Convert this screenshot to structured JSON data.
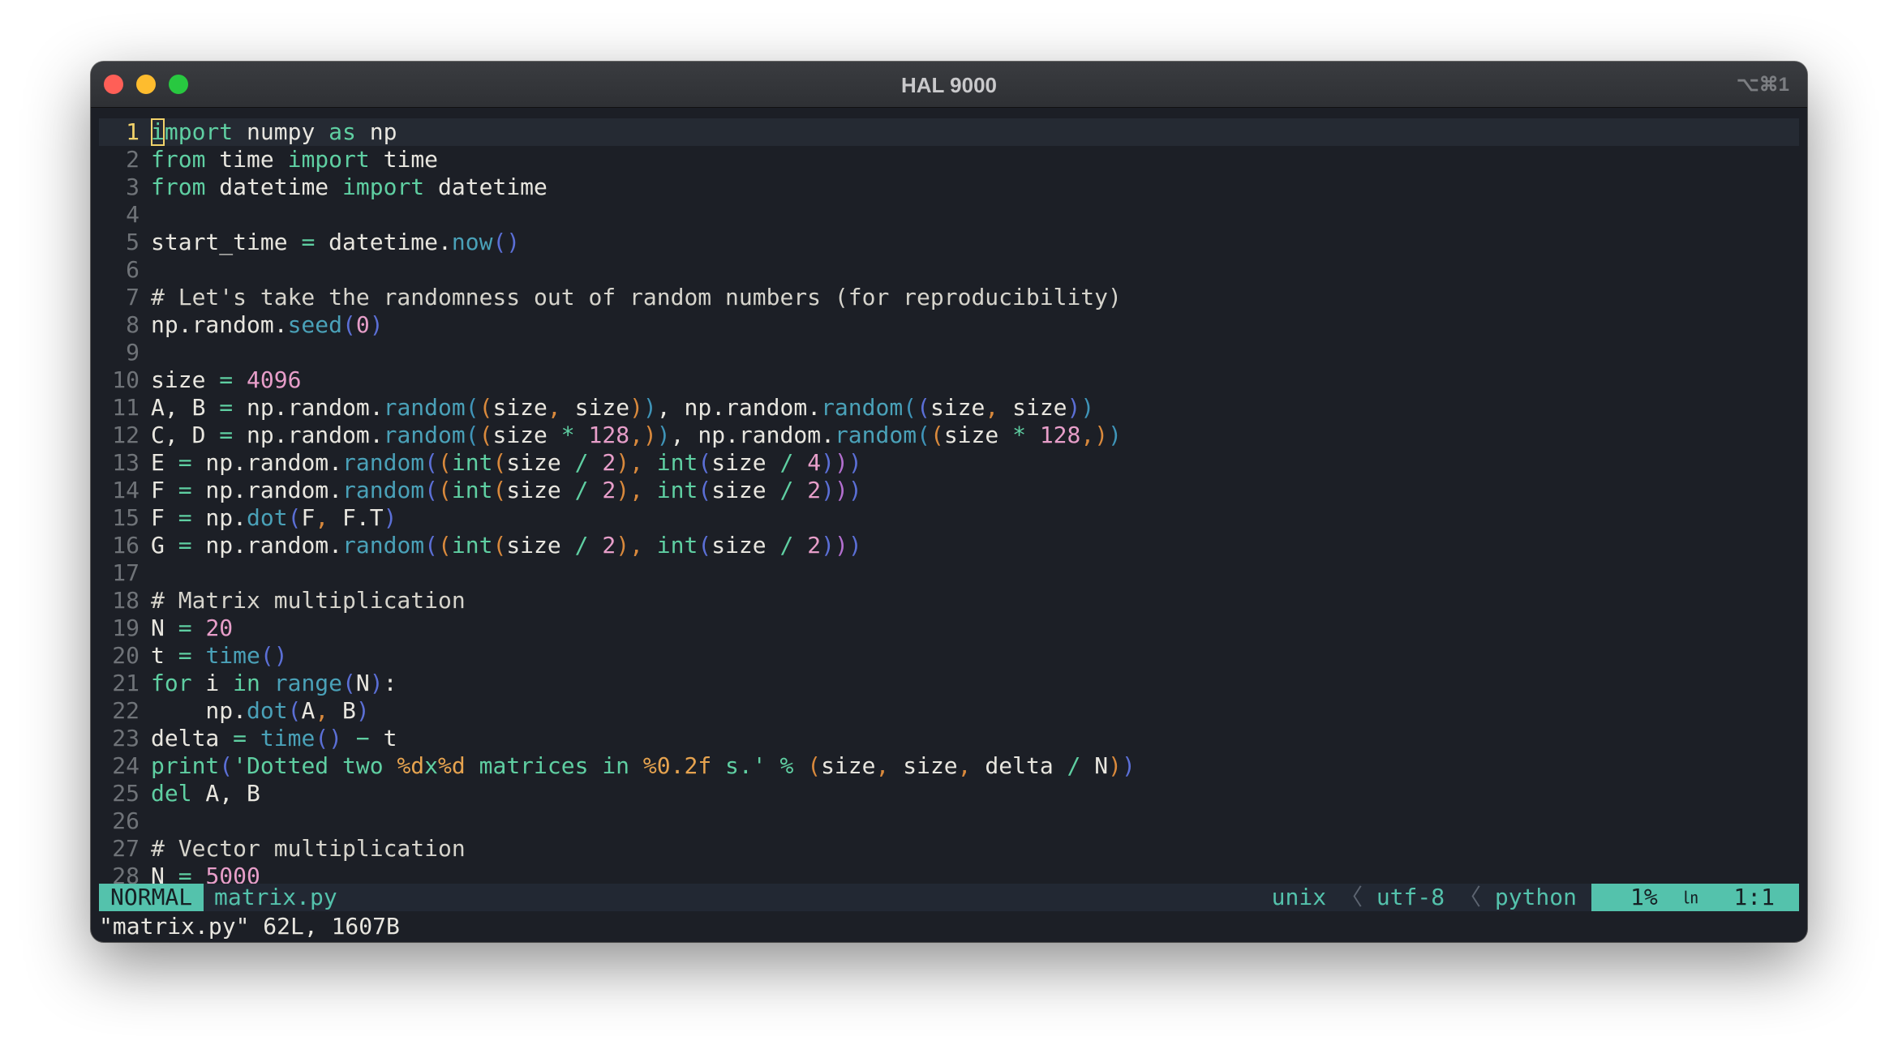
{
  "window": {
    "title": "HAL 9000",
    "shortcut": "⌥⌘1"
  },
  "editor": {
    "current_line": 1,
    "lines": [
      {
        "n": "1",
        "tokens": [
          {
            "t": "i",
            "c": "t-kw cursor"
          },
          {
            "t": "mport",
            "c": "t-kw"
          },
          {
            "t": " numpy "
          },
          {
            "t": "as",
            "c": "t-kw"
          },
          {
            "t": " np"
          }
        ]
      },
      {
        "n": "2",
        "tokens": [
          {
            "t": "from",
            "c": "t-kw"
          },
          {
            "t": " time "
          },
          {
            "t": "import",
            "c": "t-kw"
          },
          {
            "t": " time"
          }
        ]
      },
      {
        "n": "3",
        "tokens": [
          {
            "t": "from",
            "c": "t-kw"
          },
          {
            "t": " datetime "
          },
          {
            "t": "import",
            "c": "t-kw"
          },
          {
            "t": " datetime"
          }
        ]
      },
      {
        "n": "4",
        "tokens": []
      },
      {
        "n": "5",
        "tokens": [
          {
            "t": "start_time "
          },
          {
            "t": "=",
            "c": "t-op"
          },
          {
            "t": " datetime."
          },
          {
            "t": "now",
            "c": "t-fn"
          },
          {
            "t": "()",
            "c": "t-p2"
          }
        ]
      },
      {
        "n": "6",
        "tokens": []
      },
      {
        "n": "7",
        "tokens": [
          {
            "t": "# Let's take the randomness out of random numbers (for reproducibility)",
            "c": "t-cm"
          }
        ]
      },
      {
        "n": "8",
        "tokens": [
          {
            "t": "np.random."
          },
          {
            "t": "seed",
            "c": "t-fn"
          },
          {
            "t": "(",
            "c": "t-p2"
          },
          {
            "t": "0",
            "c": "t-num"
          },
          {
            "t": ")",
            "c": "t-p2"
          }
        ]
      },
      {
        "n": "9",
        "tokens": []
      },
      {
        "n": "10",
        "tokens": [
          {
            "t": "size "
          },
          {
            "t": "=",
            "c": "t-op"
          },
          {
            "t": " "
          },
          {
            "t": "4096",
            "c": "t-num"
          }
        ]
      },
      {
        "n": "11",
        "tokens": [
          {
            "t": "A, B "
          },
          {
            "t": "=",
            "c": "t-op"
          },
          {
            "t": " np.random."
          },
          {
            "t": "random",
            "c": "t-fn"
          },
          {
            "t": "(",
            "c": "t-p3"
          },
          {
            "t": "(",
            "c": "t-p1"
          },
          {
            "t": "size"
          },
          {
            "t": ",",
            "c": "t-p1"
          },
          {
            "t": " size"
          },
          {
            "t": ")",
            "c": "t-p1"
          },
          {
            "t": ")",
            "c": "t-p3"
          },
          {
            "t": ", np.random."
          },
          {
            "t": "random",
            "c": "t-fn"
          },
          {
            "t": "(",
            "c": "t-p3"
          },
          {
            "t": "(",
            "c": "t-p2"
          },
          {
            "t": "size"
          },
          {
            "t": ",",
            "c": "t-p1"
          },
          {
            "t": " size"
          },
          {
            "t": ")",
            "c": "t-p2"
          },
          {
            "t": ")",
            "c": "t-p3"
          }
        ]
      },
      {
        "n": "12",
        "tokens": [
          {
            "t": "C, D "
          },
          {
            "t": "=",
            "c": "t-op"
          },
          {
            "t": " np.random."
          },
          {
            "t": "random",
            "c": "t-fn"
          },
          {
            "t": "(",
            "c": "t-p3"
          },
          {
            "t": "(",
            "c": "t-p1"
          },
          {
            "t": "size "
          },
          {
            "t": "*",
            "c": "t-op"
          },
          {
            "t": " "
          },
          {
            "t": "128",
            "c": "t-num"
          },
          {
            "t": ",",
            "c": "t-p1"
          },
          {
            "t": ")",
            "c": "t-p1"
          },
          {
            "t": ")",
            "c": "t-p3"
          },
          {
            "t": ", np.random."
          },
          {
            "t": "random",
            "c": "t-fn"
          },
          {
            "t": "(",
            "c": "t-p3"
          },
          {
            "t": "(",
            "c": "t-p1"
          },
          {
            "t": "size "
          },
          {
            "t": "*",
            "c": "t-op"
          },
          {
            "t": " "
          },
          {
            "t": "128",
            "c": "t-num"
          },
          {
            "t": ",",
            "c": "t-p1"
          },
          {
            "t": ")",
            "c": "t-p1"
          },
          {
            "t": ")",
            "c": "t-p3"
          }
        ]
      },
      {
        "n": "13",
        "tokens": [
          {
            "t": "E "
          },
          {
            "t": "=",
            "c": "t-op"
          },
          {
            "t": " np.random."
          },
          {
            "t": "random",
            "c": "t-fn"
          },
          {
            "t": "(",
            "c": "t-p2"
          },
          {
            "t": "(",
            "c": "t-p1"
          },
          {
            "t": "int",
            "c": "t-kw"
          },
          {
            "t": "(",
            "c": "t-p1"
          },
          {
            "t": "size "
          },
          {
            "t": "/",
            "c": "t-op"
          },
          {
            "t": " "
          },
          {
            "t": "2",
            "c": "t-num"
          },
          {
            "t": ")",
            "c": "t-p1"
          },
          {
            "t": ",",
            "c": "t-p1"
          },
          {
            "t": " "
          },
          {
            "t": "int",
            "c": "t-kw"
          },
          {
            "t": "(",
            "c": "t-p2"
          },
          {
            "t": "size "
          },
          {
            "t": "/",
            "c": "t-op"
          },
          {
            "t": " "
          },
          {
            "t": "4",
            "c": "t-num"
          },
          {
            "t": ")",
            "c": "t-p2"
          },
          {
            "t": ")",
            "c": "t-p4"
          },
          {
            "t": ")",
            "c": "t-p2"
          }
        ]
      },
      {
        "n": "14",
        "tokens": [
          {
            "t": "F "
          },
          {
            "t": "=",
            "c": "t-op"
          },
          {
            "t": " np.random."
          },
          {
            "t": "random",
            "c": "t-fn"
          },
          {
            "t": "(",
            "c": "t-p2"
          },
          {
            "t": "(",
            "c": "t-p1"
          },
          {
            "t": "int",
            "c": "t-kw"
          },
          {
            "t": "(",
            "c": "t-p1"
          },
          {
            "t": "size "
          },
          {
            "t": "/",
            "c": "t-op"
          },
          {
            "t": " "
          },
          {
            "t": "2",
            "c": "t-num"
          },
          {
            "t": ")",
            "c": "t-p1"
          },
          {
            "t": ",",
            "c": "t-p1"
          },
          {
            "t": " "
          },
          {
            "t": "int",
            "c": "t-kw"
          },
          {
            "t": "(",
            "c": "t-p2"
          },
          {
            "t": "size "
          },
          {
            "t": "/",
            "c": "t-op"
          },
          {
            "t": " "
          },
          {
            "t": "2",
            "c": "t-num"
          },
          {
            "t": ")",
            "c": "t-p2"
          },
          {
            "t": ")",
            "c": "t-p4"
          },
          {
            "t": ")",
            "c": "t-p2"
          }
        ]
      },
      {
        "n": "15",
        "tokens": [
          {
            "t": "F "
          },
          {
            "t": "=",
            "c": "t-op"
          },
          {
            "t": " np."
          },
          {
            "t": "dot",
            "c": "t-fn"
          },
          {
            "t": "(",
            "c": "t-p2"
          },
          {
            "t": "F"
          },
          {
            "t": ",",
            "c": "t-p1"
          },
          {
            "t": " F.T"
          },
          {
            "t": ")",
            "c": "t-p2"
          }
        ]
      },
      {
        "n": "16",
        "tokens": [
          {
            "t": "G "
          },
          {
            "t": "=",
            "c": "t-op"
          },
          {
            "t": " np.random."
          },
          {
            "t": "random",
            "c": "t-fn"
          },
          {
            "t": "(",
            "c": "t-p2"
          },
          {
            "t": "(",
            "c": "t-p1"
          },
          {
            "t": "int",
            "c": "t-kw"
          },
          {
            "t": "(",
            "c": "t-p1"
          },
          {
            "t": "size "
          },
          {
            "t": "/",
            "c": "t-op"
          },
          {
            "t": " "
          },
          {
            "t": "2",
            "c": "t-num"
          },
          {
            "t": ")",
            "c": "t-p1"
          },
          {
            "t": ",",
            "c": "t-p1"
          },
          {
            "t": " "
          },
          {
            "t": "int",
            "c": "t-kw"
          },
          {
            "t": "(",
            "c": "t-p2"
          },
          {
            "t": "size "
          },
          {
            "t": "/",
            "c": "t-op"
          },
          {
            "t": " "
          },
          {
            "t": "2",
            "c": "t-num"
          },
          {
            "t": ")",
            "c": "t-p2"
          },
          {
            "t": ")",
            "c": "t-p4"
          },
          {
            "t": ")",
            "c": "t-p2"
          }
        ]
      },
      {
        "n": "17",
        "tokens": []
      },
      {
        "n": "18",
        "tokens": [
          {
            "t": "# Matrix multiplication",
            "c": "t-cm"
          }
        ]
      },
      {
        "n": "19",
        "tokens": [
          {
            "t": "N "
          },
          {
            "t": "=",
            "c": "t-op"
          },
          {
            "t": " "
          },
          {
            "t": "20",
            "c": "t-num"
          }
        ]
      },
      {
        "n": "20",
        "tokens": [
          {
            "t": "t "
          },
          {
            "t": "=",
            "c": "t-op"
          },
          {
            "t": " "
          },
          {
            "t": "time",
            "c": "t-fn"
          },
          {
            "t": "()",
            "c": "t-p2"
          }
        ]
      },
      {
        "n": "21",
        "tokens": [
          {
            "t": "for",
            "c": "t-kw"
          },
          {
            "t": " i "
          },
          {
            "t": "in",
            "c": "t-kw"
          },
          {
            "t": " "
          },
          {
            "t": "range",
            "c": "t-fn"
          },
          {
            "t": "(",
            "c": "t-p2"
          },
          {
            "t": "N"
          },
          {
            "t": ")",
            "c": "t-p2"
          },
          {
            "t": ":"
          }
        ]
      },
      {
        "n": "22",
        "tokens": [
          {
            "t": "    np."
          },
          {
            "t": "dot",
            "c": "t-fn"
          },
          {
            "t": "(",
            "c": "t-p2"
          },
          {
            "t": "A"
          },
          {
            "t": ",",
            "c": "t-p1"
          },
          {
            "t": " B"
          },
          {
            "t": ")",
            "c": "t-p2"
          }
        ]
      },
      {
        "n": "23",
        "tokens": [
          {
            "t": "delta "
          },
          {
            "t": "=",
            "c": "t-op"
          },
          {
            "t": " "
          },
          {
            "t": "time",
            "c": "t-fn"
          },
          {
            "t": "()",
            "c": "t-p2"
          },
          {
            "t": " "
          },
          {
            "t": "−",
            "c": "t-op"
          },
          {
            "t": " t"
          }
        ]
      },
      {
        "n": "24",
        "tokens": [
          {
            "t": "print",
            "c": "t-kw"
          },
          {
            "t": "(",
            "c": "t-p2"
          },
          {
            "t": "'Dotted two ",
            "c": "t-kw"
          },
          {
            "t": "%d",
            "c": "t-str"
          },
          {
            "t": "x",
            "c": "t-kw"
          },
          {
            "t": "%d",
            "c": "t-str"
          },
          {
            "t": " matrices in ",
            "c": "t-kw"
          },
          {
            "t": "%0.2f",
            "c": "t-str"
          },
          {
            "t": " s.'",
            "c": "t-kw"
          },
          {
            "t": " "
          },
          {
            "t": "%",
            "c": "t-op"
          },
          {
            "t": " "
          },
          {
            "t": "(",
            "c": "t-p1"
          },
          {
            "t": "size"
          },
          {
            "t": ",",
            "c": "t-p1"
          },
          {
            "t": " size"
          },
          {
            "t": ",",
            "c": "t-p1"
          },
          {
            "t": " delta "
          },
          {
            "t": "/",
            "c": "t-op"
          },
          {
            "t": " N"
          },
          {
            "t": ")",
            "c": "t-p1"
          },
          {
            "t": ")",
            "c": "t-p2"
          }
        ]
      },
      {
        "n": "25",
        "tokens": [
          {
            "t": "del",
            "c": "t-kw"
          },
          {
            "t": " A, B"
          }
        ]
      },
      {
        "n": "26",
        "tokens": []
      },
      {
        "n": "27",
        "tokens": [
          {
            "t": "# Vector multiplication",
            "c": "t-cm"
          }
        ]
      },
      {
        "n": "28",
        "tokens": [
          {
            "t": "N "
          },
          {
            "t": "=",
            "c": "t-op"
          },
          {
            "t": " "
          },
          {
            "t": "5000",
            "c": "t-num"
          }
        ]
      }
    ]
  },
  "statusline": {
    "mode": "NORMAL",
    "filename": "matrix.py",
    "fileformat": "unix",
    "encoding": "utf-8",
    "filetype": "python",
    "separator": "〈",
    "percent": "1%",
    "line_icon": "㏑",
    "position": "1:1"
  },
  "cmdline": {
    "message": "\"matrix.py\" 62L, 1607B"
  },
  "colors": {
    "background": "#1c1f26",
    "accent": "#54c2ac",
    "keyword": "#5fcfa2",
    "function": "#4aa1b8",
    "number": "#e79ec9",
    "string_format": "#e6a34f"
  }
}
